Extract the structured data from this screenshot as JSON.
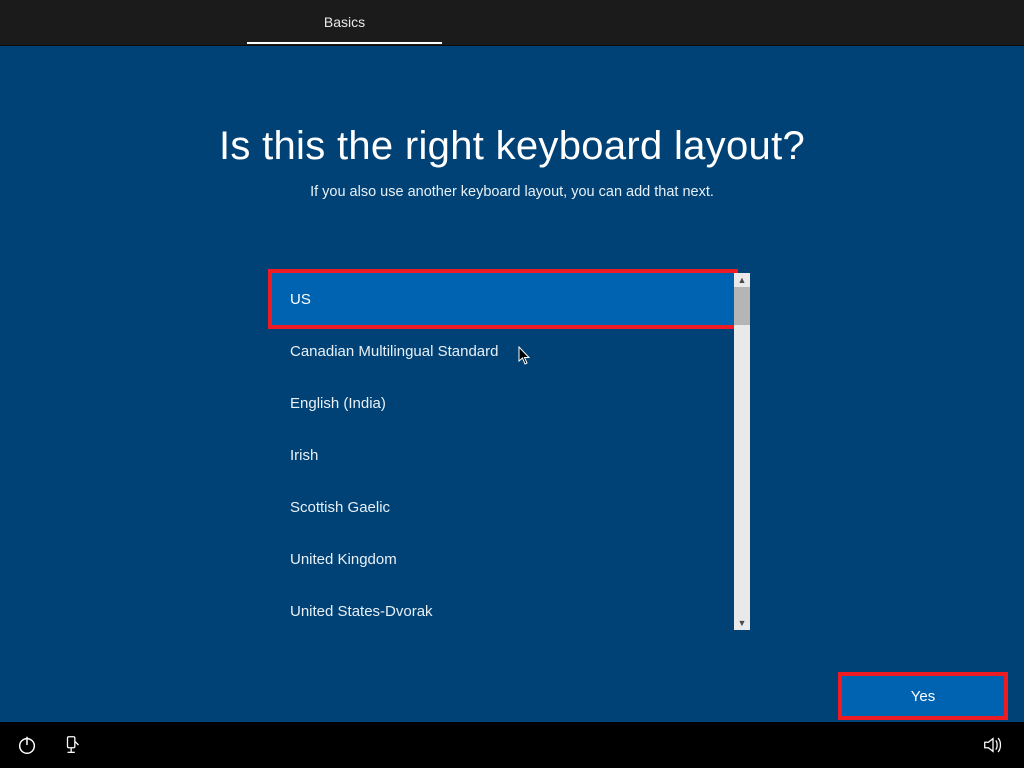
{
  "header": {
    "tab_label": "Basics"
  },
  "headline": "Is this the right keyboard layout?",
  "subhead": "If you also use another keyboard layout, you can add that next.",
  "list": {
    "selected": "US",
    "items": [
      "Canadian Multilingual Standard",
      "English (India)",
      "Irish",
      "Scottish Gaelic",
      "United Kingdom",
      "United States-Dvorak"
    ]
  },
  "buttons": {
    "yes": "Yes"
  },
  "colors": {
    "accent": "#0063b1",
    "panel_bg": "#004275",
    "highlight": "#ed1c24"
  }
}
